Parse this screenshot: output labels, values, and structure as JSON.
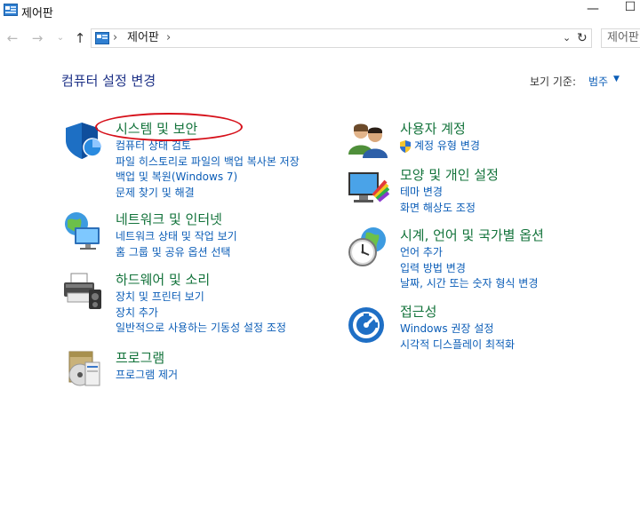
{
  "window": {
    "title": "제어판"
  },
  "address": {
    "crumb": "제어판",
    "search_placeholder": "제어판"
  },
  "page": {
    "heading": "컴퓨터 설정 변경",
    "view_by_label": "보기 기준:",
    "view_by_value": "범주"
  },
  "categories": [
    {
      "title": "시스템 및 보안",
      "icon": "shield-icon",
      "links": [
        "컴퓨터 상태 검토",
        "파일 히스토리로 파일의 백업 복사본 저장",
        "백업 및 복원(Windows 7)",
        "문제 찾기 및 해결"
      ]
    },
    {
      "title": "네트워크 및 인터넷",
      "icon": "network-icon",
      "links": [
        "네트워크 상태 및 작업 보기",
        "홈 그룹 및 공유 옵션 선택"
      ]
    },
    {
      "title": "하드웨어 및 소리",
      "icon": "printer-icon",
      "links": [
        "장치 및 프린터 보기",
        "장치 추가",
        "일반적으로 사용하는 기동성 설정 조정"
      ]
    },
    {
      "title": "프로그램",
      "icon": "programs-icon",
      "links": [
        "프로그램 제거"
      ]
    },
    {
      "title": "사용자 계정",
      "icon": "users-icon",
      "links": [
        "계정 유형 변경"
      ]
    },
    {
      "title": "모양 및 개인 설정",
      "icon": "personalization-icon",
      "links": [
        "테마 변경",
        "화면 해상도 조정"
      ]
    },
    {
      "title": "시계, 언어 및 국가별 옵션",
      "icon": "clock-icon",
      "links": [
        "언어 추가",
        "입력 방법 변경",
        "날짜, 시간 또는 숫자 형식 변경"
      ]
    },
    {
      "title": "접근성",
      "icon": "accessibility-icon",
      "links": [
        "Windows 권장 설정",
        "시각적 디스플레이 최적화"
      ]
    }
  ],
  "colors": {
    "category_title": "#13733b",
    "link": "#0b5db7",
    "heading": "#1e3287",
    "annotation": "#d6101a"
  }
}
